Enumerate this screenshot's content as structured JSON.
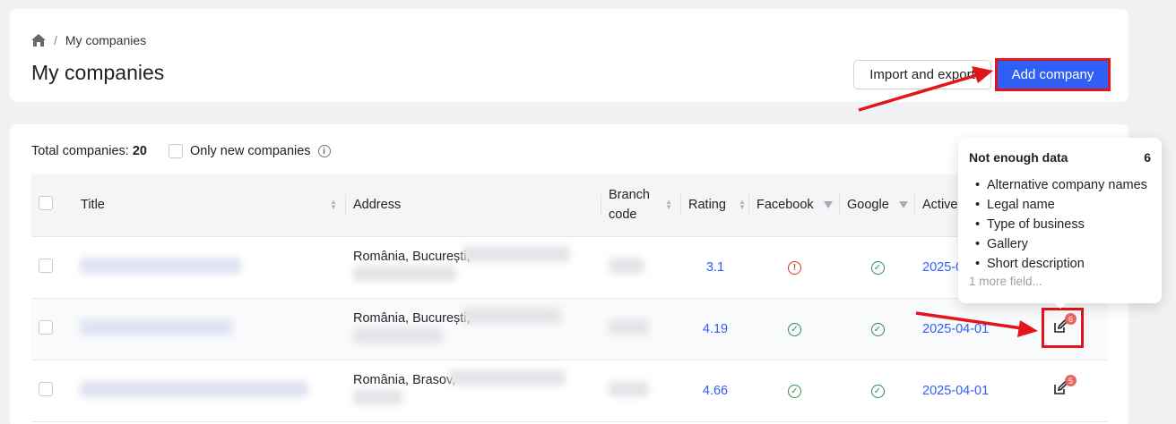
{
  "breadcrumb": {
    "home_icon": "home-icon",
    "current": "My companies"
  },
  "header": {
    "title": "My companies",
    "import_label": "Import and export",
    "add_label": "Add company"
  },
  "toolbar": {
    "total_label": "Total companies:",
    "total_count": "20",
    "only_new_label": "Only new companies",
    "info_icon": "info-icon"
  },
  "table": {
    "columns": [
      "Title",
      "Address",
      "Branch code",
      "Rating",
      "Facebook",
      "Google",
      "Active"
    ],
    "rows": [
      {
        "address": "România, București,",
        "rating": "3.1",
        "facebook": "error",
        "google": "ok",
        "active": "2025-04-01",
        "badge": ""
      },
      {
        "address": "România, București,",
        "rating": "4.19",
        "facebook": "ok",
        "google": "ok",
        "active": "2025-04-01",
        "badge": "6"
      },
      {
        "address": "România, Brasov,",
        "rating": "4.66",
        "facebook": "ok",
        "google": "ok",
        "active": "2025-04-01",
        "badge": "5"
      }
    ]
  },
  "tooltip": {
    "title": "Not enough data",
    "count": "6",
    "items": [
      "Alternative company names",
      "Legal name",
      "Type of business",
      "Gallery",
      "Short description"
    ],
    "more": "1 more field..."
  },
  "colors": {
    "accent": "#2f5ff5",
    "annotation": "#e3141b",
    "ok": "#2e8b57",
    "error": "#d9312b"
  }
}
